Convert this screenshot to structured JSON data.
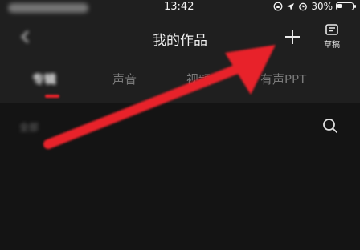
{
  "status_bar": {
    "carrier": "",
    "time": "13:42",
    "battery_percent_text": "30%",
    "battery_level": 0.3
  },
  "header": {
    "title": "我的作品",
    "draft_label": "草稿"
  },
  "tabs": [
    {
      "label": "专辑",
      "active": true
    },
    {
      "label": "声音",
      "active": false
    },
    {
      "label": "视频",
      "active": false
    },
    {
      "label": "有声PPT",
      "active": false
    }
  ],
  "filter": {
    "label": "全部"
  },
  "colors": {
    "accent_red": "#e8222a",
    "background": "#141414",
    "header_bg": "#1f1f1f"
  },
  "icons": [
    "back-icon",
    "add-icon",
    "draft-icon",
    "search-icon",
    "alarm-icon",
    "location-icon",
    "lock-rotation-icon",
    "battery-icon"
  ]
}
